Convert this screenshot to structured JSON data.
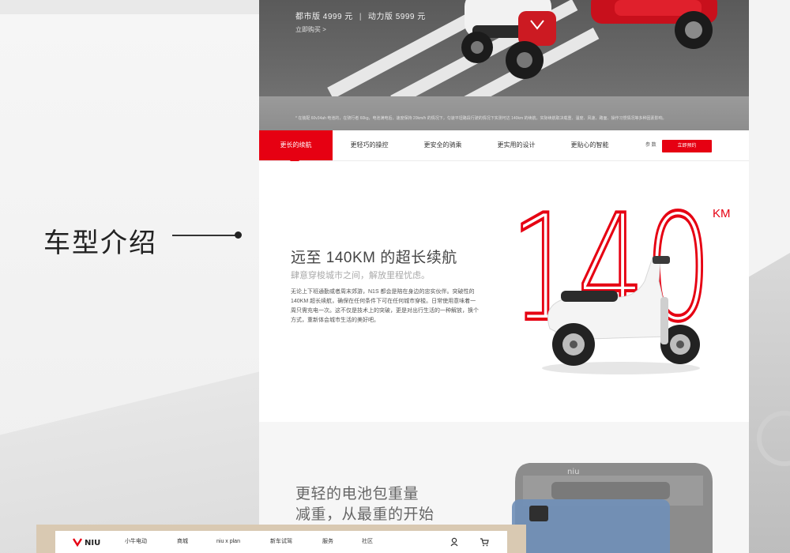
{
  "annotation": {
    "label": "车型介绍"
  },
  "hero": {
    "price_standard": "都市版 4999 元",
    "price_power": "动力版 5999 元",
    "buy_link": "立即购买 >",
    "footnote": "* 在装配 60v34ah 电池的，在骑行者 60kg，电池满电后，速度保持 20km/h 的情况下，匀速平坦路段行驶的情况下实测可达 140km 的续航。实际续航取决载重、温度、风速、路面、操作习惯情况等多种因素影响。"
  },
  "tabs": {
    "items": [
      "更长的续航",
      "更轻巧的操控",
      "更安全的骑乘",
      "更实用的设计",
      "更贴心的智能"
    ],
    "active_index": 0,
    "params_label": "参 数",
    "cta_label": "立即预约"
  },
  "range": {
    "big_number": "140",
    "unit": "KM",
    "title": "远至 140KM 的超长续航",
    "subtitle": "肆意穿梭城市之间，解放里程忧虑。",
    "body": "无论上下班通勤或者周末郊游，N1S 都会是陪在身边的忠实伙伴。突破性的 140KM 超长续航，确保在任何条件下可在任何城市穿梭。日常使用意味着一周只需充电一次。这不仅是技术上的突破，更是对出行生活的一种解放，换个方式，重新体会城市生活的美好吧。"
  },
  "battery": {
    "title_line1": "更轻的电池包重量",
    "title_line2": "减重，从最重的开始",
    "brand_mark": "niu"
  },
  "bottom_nav": {
    "logo": "NIU",
    "items": [
      "小牛电动",
      "商城",
      "niu x plan",
      "新车试驾",
      "服务",
      "社区"
    ],
    "icons": [
      "user-icon",
      "cart-icon"
    ]
  },
  "colors": {
    "brand_red": "#e60012"
  }
}
